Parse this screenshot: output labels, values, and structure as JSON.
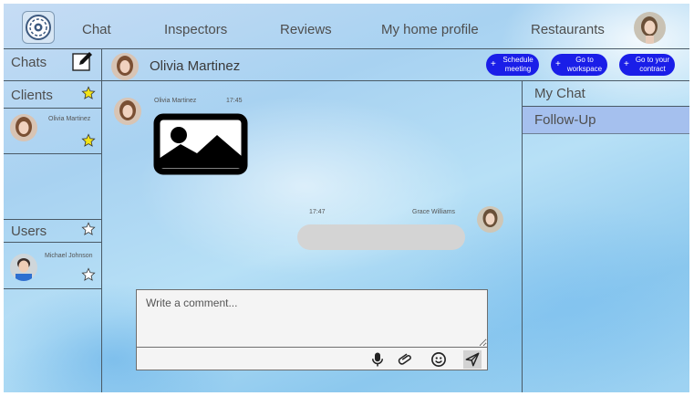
{
  "nav": {
    "items": [
      "Chat",
      "Inspectors",
      "Reviews",
      "My home profile",
      "Restaurants"
    ]
  },
  "sidebar": {
    "chats_label": "Chats",
    "clients_label": "Clients",
    "clients": [
      {
        "name": "Olivia Martinez"
      }
    ],
    "users_label": "Users",
    "users": [
      {
        "name": "Michael Johnson"
      }
    ]
  },
  "header": {
    "contact_name": "Olivia Martinez",
    "actions": [
      {
        "line1": "Schedule",
        "line2": "meeting"
      },
      {
        "line1": "Go to",
        "line2": "workspace"
      },
      {
        "line1": "Go to your",
        "line2": "contract"
      }
    ]
  },
  "messages": [
    {
      "sender": "Olivia Martinez",
      "time": "17:45",
      "kind": "image-icon"
    },
    {
      "sender": "Grace Williams",
      "time": "17:47",
      "kind": "text"
    }
  ],
  "composer": {
    "placeholder": "Write a comment..."
  },
  "right_panel": {
    "items": [
      "My Chat",
      "Follow-Up"
    ],
    "selected_index": 1
  },
  "colors": {
    "accent": "#1a1ee8",
    "selected_row": "#a5c0ee",
    "star": "#f3e417",
    "divider": "#4a5a66"
  }
}
